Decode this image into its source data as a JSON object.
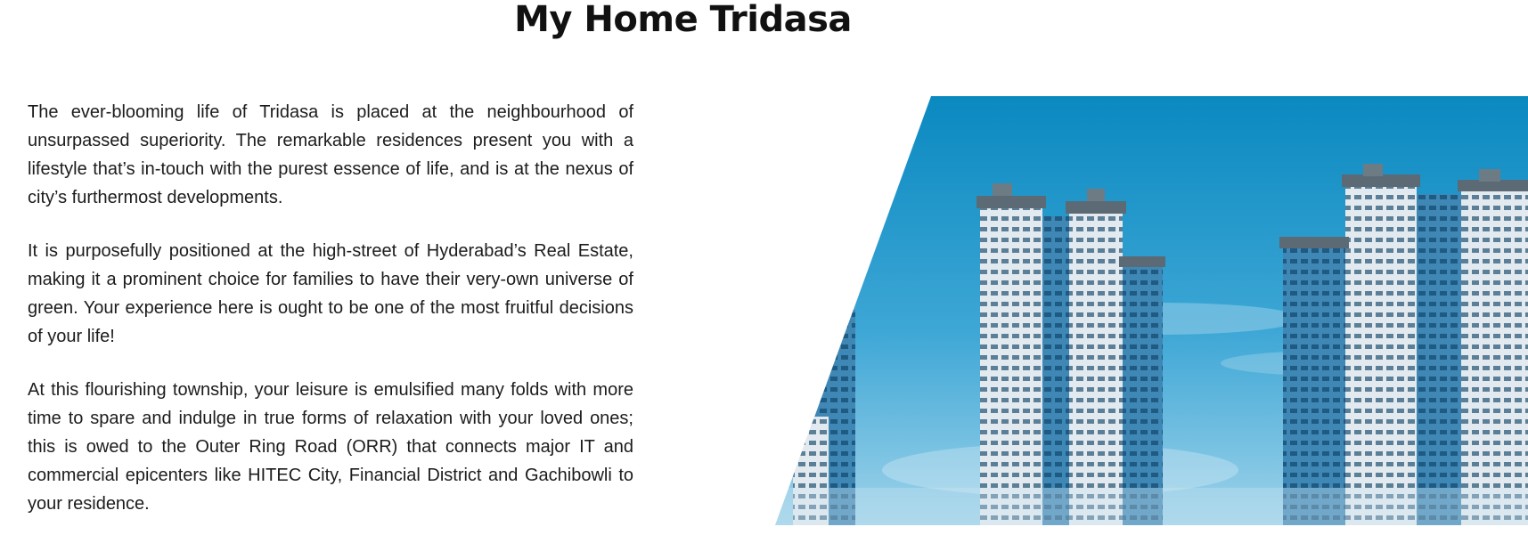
{
  "page": {
    "title": "My Home Tridasa"
  },
  "content": {
    "paragraphs": [
      "The ever-blooming life of Tridasa is placed at the neighbourhood of unsurpassed superiority. The remarkable residences present you with a lifestyle that’s in-touch with the purest essence of life, and is at the nexus of city’s furthermost developments.",
      "It is purposefully positioned at the high-street of Hyderabad’s Real Estate, making it a prominent choice for families to have their very-own universe of green. Your experience here is ought to be one of the most fruitful decisions of your life!",
      "At this flourishing township, your leisure is emulsified many folds with more time to spare and indulge in true forms of relaxation with your loved ones; this is owed to the Outer Ring Road (ORR) that connects major IT and commercial epicenters like HITEC City, Financial District and Gachibowli to your residence."
    ]
  },
  "image": {
    "subject": "residential-towers-render",
    "sky_color_top": "#0a8bc2",
    "sky_color_bottom": "#7cc6e6"
  }
}
